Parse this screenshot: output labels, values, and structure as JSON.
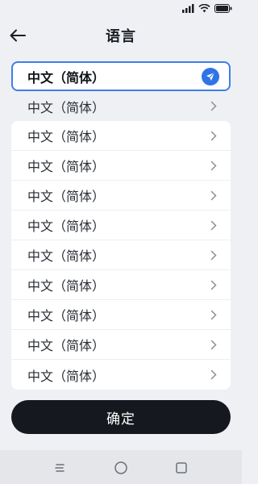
{
  "header": {
    "title": "语言"
  },
  "languages": {
    "selected": "中文（简体）",
    "second": "中文（简体）",
    "items": [
      "中文（简体）",
      "中文（简体）",
      "中文（简体）",
      "中文（简体）",
      "中文（简体）",
      "中文（简体）",
      "中文（简体）",
      "中文（简体）",
      "中文（简体）"
    ]
  },
  "confirm": {
    "label": "确定"
  },
  "colors": {
    "accent": "#2f74e6",
    "button_dark": "#15181e"
  },
  "icons": {
    "back": "arrow-left-icon",
    "selected": "send-check-icon",
    "row": "chevron-right-icon",
    "nav_menu": "menu-icon",
    "nav_home": "home-circle-icon",
    "nav_recent": "recent-square-icon"
  }
}
